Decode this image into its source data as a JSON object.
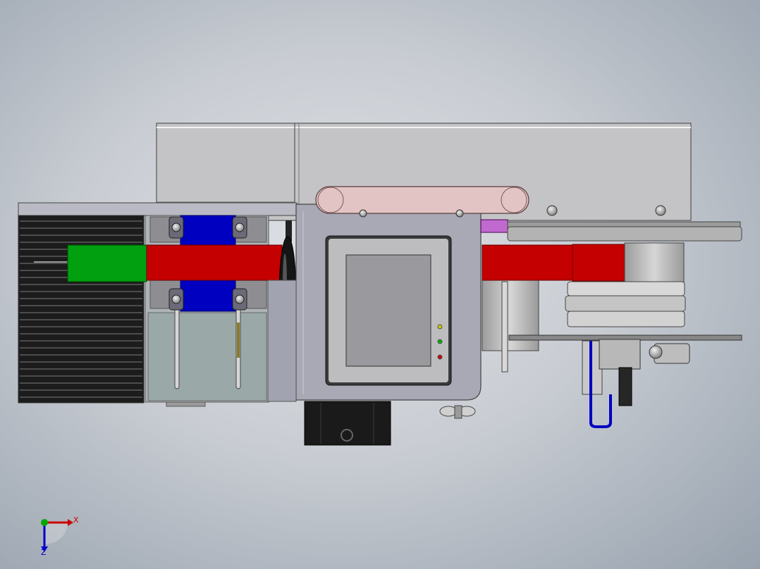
{
  "triad": {
    "x_label": "X",
    "z_label": "Z",
    "x_color": "#cc0000",
    "y_color": "#00aa00",
    "z_color": "#0000cc"
  },
  "colors": {
    "housing_gray": "#c4c4c6",
    "panel_gray": "#a8a9b5",
    "red_band": "#c40000",
    "green_block": "#00a010",
    "blue_clamp": "#0000c0",
    "rail_pink": "#e2c4c4",
    "screen_gray": "#9a9a9e",
    "heatsink_dark": "#1c1c1c"
  },
  "indicators": {
    "led_top": "#c8c800",
    "led_mid": "#00b000",
    "led_bottom": "#cc0000"
  }
}
